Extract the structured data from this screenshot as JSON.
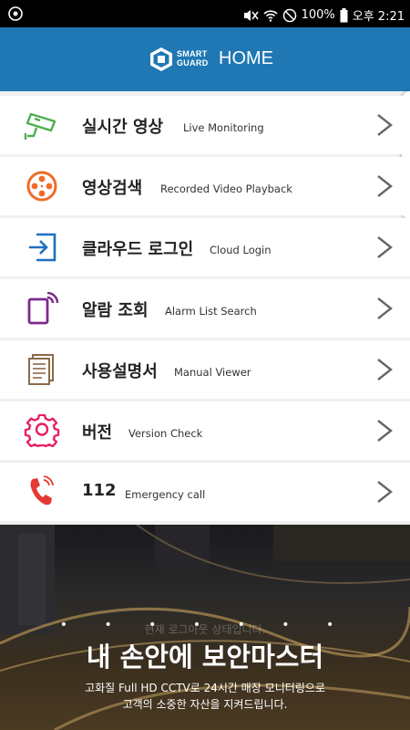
{
  "status_bar": {
    "battery": "100%",
    "time": "오후 2:21"
  },
  "header": {
    "logo_line1": "SMART",
    "logo_line2": "GUARD",
    "title": "HOME"
  },
  "menu": {
    "items": [
      {
        "ko": "실시간 영상",
        "en": "Live Monitoring",
        "icon": "cctv-camera-icon"
      },
      {
        "ko": "영상검색",
        "en": "Recorded Video Playback",
        "icon": "film-reel-icon"
      },
      {
        "ko": "클라우드 로그인",
        "en": "Cloud Login",
        "icon": "login-icon"
      },
      {
        "ko": "알람 조회",
        "en": "Alarm List Search",
        "icon": "tablet-alarm-icon"
      },
      {
        "ko": "사용설명서",
        "en": "Manual Viewer",
        "icon": "document-icon"
      },
      {
        "ko": "버전",
        "en": "Version Check",
        "icon": "gear-icon"
      },
      {
        "ko": "112",
        "en": "Emergency call",
        "icon": "phone-icon"
      }
    ]
  },
  "banner": {
    "faded_text": "현재 로그아웃 상태입니다.",
    "title": "내 손안에 보안마스터",
    "sub1": "고화질 Full HD CCTV로 24시간 매장 모니터링으로",
    "sub2": "고객의 소중한 자산을 지켜드립니다."
  },
  "colors": {
    "header": "#1f78b4",
    "icon_green": "#4caf50",
    "icon_orange": "#ef6c2a",
    "icon_blue": "#1e6fc0",
    "icon_purple": "#7b2a8c",
    "icon_brown": "#8a6a4a",
    "icon_pink": "#e91e63",
    "icon_red": "#e53935"
  }
}
